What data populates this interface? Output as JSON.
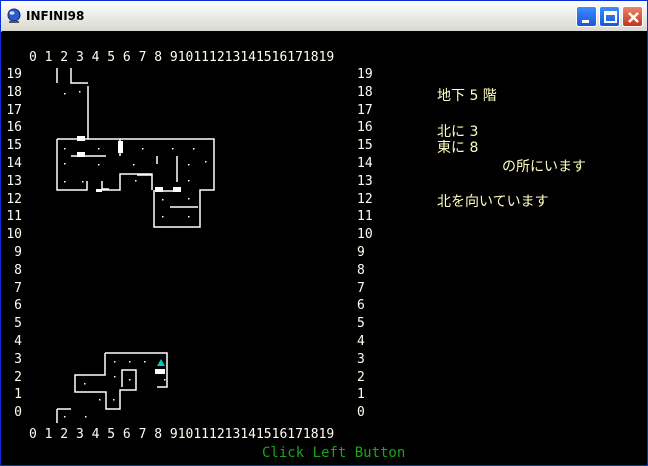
{
  "window": {
    "title": "INFINI98",
    "icon": "app-globe-icon",
    "controls": [
      "minimize-icon",
      "maximize-icon",
      "close-icon"
    ]
  },
  "map": {
    "top_axis": "0 1 2 3 4 5 6 7 8 910111213141516171819",
    "bottom_axis": "0 1 2 3 4 5 6 7 8 910111213141516171819",
    "row_labels": [
      "19",
      "18",
      "17",
      "16",
      "15",
      "14",
      "13",
      "12",
      "11",
      "10",
      "9",
      "8",
      "7",
      "6",
      "5",
      "4",
      "3",
      "2",
      "1",
      "0"
    ],
    "player_marker": "cyan-triangle",
    "colors": {
      "walls": "#ffffff",
      "background": "#000000",
      "labels": "#fffff0",
      "player": "#00c8c8"
    }
  },
  "status": {
    "floor": "地下 5 階",
    "north": "北に 3",
    "east": "東に 8",
    "location_suffix": "の所にいます",
    "facing": "北を向いています"
  },
  "prompt": "Click Left Button"
}
